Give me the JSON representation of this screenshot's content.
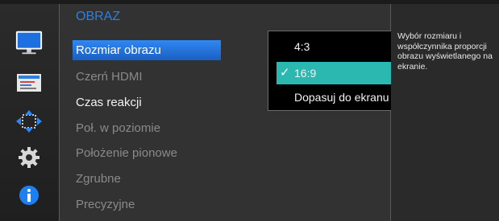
{
  "sidebar": {
    "items": [
      {
        "icon": "picture-monitor-icon",
        "active": true
      },
      {
        "icon": "onscreen-display-icon",
        "active": false
      },
      {
        "icon": "position-arrows-icon",
        "active": false
      },
      {
        "icon": "settings-gear-icon",
        "active": false
      },
      {
        "icon": "information-icon",
        "active": false
      }
    ]
  },
  "menu": {
    "title": "OBRAZ",
    "items": [
      {
        "label": "Rozmiar obrazu",
        "state": "selected"
      },
      {
        "label": "Czerń HDMI",
        "state": "disabled"
      },
      {
        "label": "Czas reakcji",
        "state": "enabled"
      },
      {
        "label": "Poł. w poziomie",
        "state": "disabled"
      },
      {
        "label": "Położenie pionowe",
        "state": "disabled"
      },
      {
        "label": "Zgrubne",
        "state": "disabled"
      },
      {
        "label": "Precyzyjne",
        "state": "disabled"
      }
    ]
  },
  "dropdown": {
    "options": [
      {
        "label": "4:3",
        "selected": false
      },
      {
        "label": "16:9",
        "selected": true
      },
      {
        "label": "Dopasuj do ekranu",
        "selected": false
      }
    ],
    "check_glyph": "✓"
  },
  "help": {
    "text": "Wybór rozmiaru i współczynnika proporcji obrazu wyświetlanego na ekranie."
  },
  "colors": {
    "title_accent": "#2f7fdc",
    "selected_item": "#2f88f2",
    "selected_option": "#2ab8b0"
  }
}
